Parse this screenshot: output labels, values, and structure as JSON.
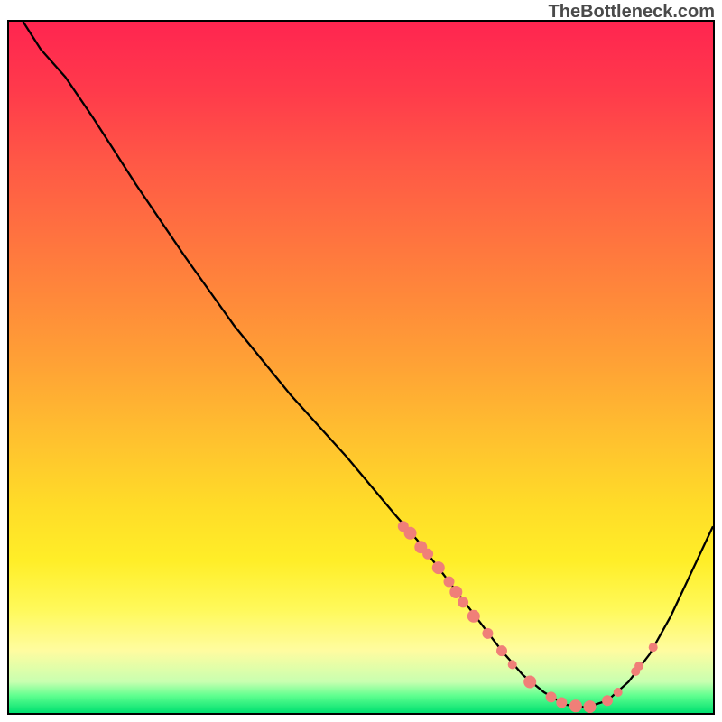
{
  "watermark": "TheBottleneck.com",
  "chart_data": {
    "type": "line",
    "title": "",
    "xlabel": "",
    "ylabel": "",
    "xlim": [
      0,
      100
    ],
    "ylim": [
      0,
      100
    ],
    "curve": [
      {
        "x": 2.0,
        "y": 100.0
      },
      {
        "x": 4.5,
        "y": 96.0
      },
      {
        "x": 8.0,
        "y": 92.0
      },
      {
        "x": 12.0,
        "y": 86.0
      },
      {
        "x": 18.0,
        "y": 76.5
      },
      {
        "x": 25.0,
        "y": 66.0
      },
      {
        "x": 32.0,
        "y": 56.0
      },
      {
        "x": 40.0,
        "y": 46.0
      },
      {
        "x": 48.0,
        "y": 37.0
      },
      {
        "x": 55.0,
        "y": 28.5
      },
      {
        "x": 58.0,
        "y": 25.0
      },
      {
        "x": 61.0,
        "y": 21.0
      },
      {
        "x": 64.0,
        "y": 17.0
      },
      {
        "x": 67.0,
        "y": 13.0
      },
      {
        "x": 70.0,
        "y": 9.0
      },
      {
        "x": 73.0,
        "y": 5.5
      },
      {
        "x": 76.0,
        "y": 3.0
      },
      {
        "x": 79.0,
        "y": 1.2
      },
      {
        "x": 82.0,
        "y": 0.8
      },
      {
        "x": 85.0,
        "y": 1.8
      },
      {
        "x": 88.0,
        "y": 4.5
      },
      {
        "x": 91.0,
        "y": 8.5
      },
      {
        "x": 94.0,
        "y": 14.0
      },
      {
        "x": 97.0,
        "y": 20.5
      },
      {
        "x": 100.0,
        "y": 27.0
      }
    ],
    "points": [
      {
        "x": 56.0,
        "y": 27.0,
        "r": 6
      },
      {
        "x": 57.0,
        "y": 26.0,
        "r": 7
      },
      {
        "x": 58.5,
        "y": 24.0,
        "r": 7
      },
      {
        "x": 59.5,
        "y": 23.0,
        "r": 6
      },
      {
        "x": 61.0,
        "y": 21.0,
        "r": 7
      },
      {
        "x": 62.5,
        "y": 19.0,
        "r": 6
      },
      {
        "x": 63.5,
        "y": 17.5,
        "r": 7
      },
      {
        "x": 64.5,
        "y": 16.0,
        "r": 6
      },
      {
        "x": 66.0,
        "y": 14.0,
        "r": 7
      },
      {
        "x": 68.0,
        "y": 11.5,
        "r": 6
      },
      {
        "x": 70.0,
        "y": 9.0,
        "r": 6
      },
      {
        "x": 71.5,
        "y": 7.0,
        "r": 5
      },
      {
        "x": 74.0,
        "y": 4.5,
        "r": 7
      },
      {
        "x": 77.0,
        "y": 2.3,
        "r": 6
      },
      {
        "x": 78.5,
        "y": 1.5,
        "r": 6
      },
      {
        "x": 80.5,
        "y": 1.0,
        "r": 7
      },
      {
        "x": 82.5,
        "y": 0.9,
        "r": 7
      },
      {
        "x": 85.0,
        "y": 1.8,
        "r": 6
      },
      {
        "x": 86.5,
        "y": 3.0,
        "r": 5
      },
      {
        "x": 89.0,
        "y": 6.0,
        "r": 5
      },
      {
        "x": 89.5,
        "y": 6.8,
        "r": 5
      },
      {
        "x": 91.5,
        "y": 9.5,
        "r": 5
      }
    ],
    "colors": {
      "curve": "#000000",
      "point_fill": "#f07f78",
      "point_stroke": "none"
    }
  }
}
